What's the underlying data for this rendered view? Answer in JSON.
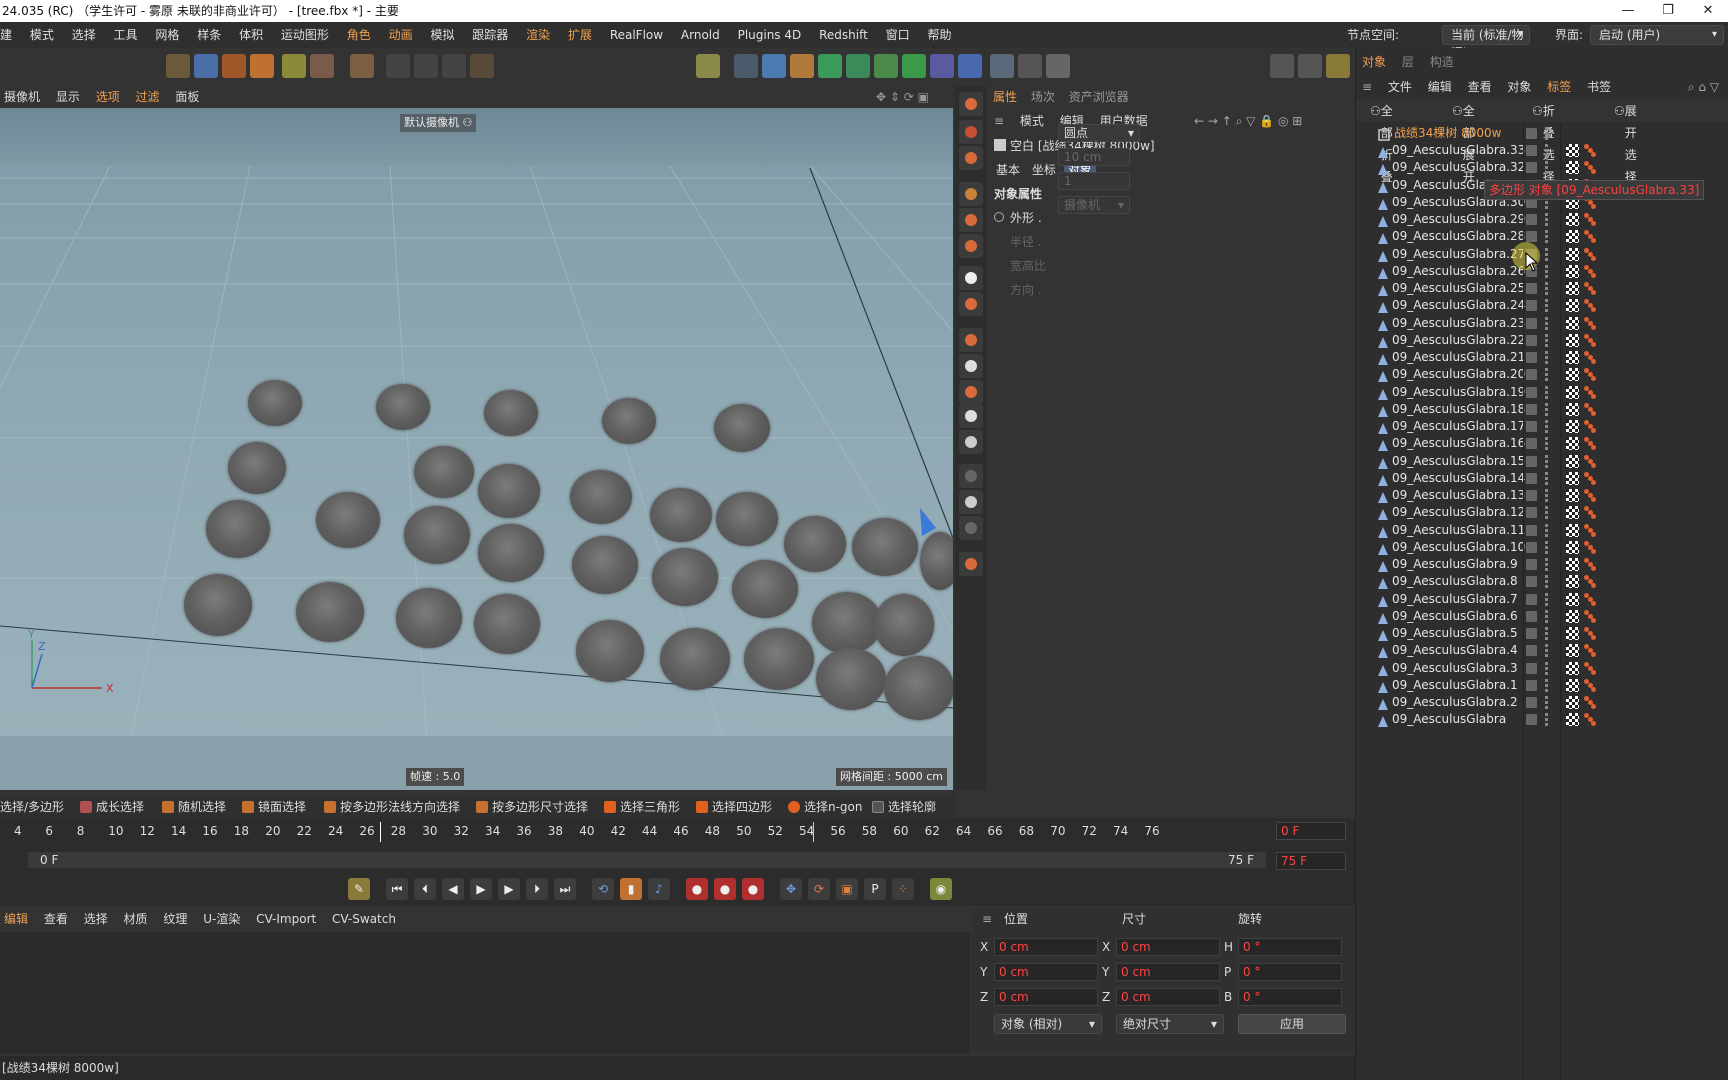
{
  "titlebar": {
    "title": "24.035 (RC)  （学生许可 - 雾原 未联的非商业许可）  - [tree.fbx *] - 主要"
  },
  "menubar": {
    "items": [
      "建",
      "模式",
      "选择",
      "工具",
      "网格",
      "样条",
      "体积",
      "运动图形",
      "角色",
      "动画",
      "模拟",
      "跟踪器",
      "渲染",
      "扩展",
      "RealFlow",
      "Arnold",
      "Plugins 4D",
      "Redshift",
      "窗口",
      "帮助"
    ],
    "node_space_label": "节点空间:",
    "node_space_value": "当前 (标准/物理)",
    "interface_label": "界面:",
    "interface_value": "启动 (用户)"
  },
  "viewport": {
    "menu": [
      "摄像机",
      "显示",
      "选项",
      "过滤",
      "面板"
    ],
    "camera_label": "默认摄像机",
    "fps": "帧速 : 5.0",
    "grid_spacing": "网格间距 : 5000 cm",
    "axis_y": "Y",
    "axis_z": "Z",
    "axis_x": "X"
  },
  "attributes": {
    "tabs": [
      "属性",
      "场次",
      "资产浏览器"
    ],
    "submenu": [
      "模式",
      "编辑",
      "用户数据"
    ],
    "object_title": "空白 [战绩34棵树 8000w]",
    "prop_tabs": [
      "基本",
      "坐标",
      "对象"
    ],
    "section": "对象属性",
    "rows": [
      {
        "label": "外形 .",
        "value": "圆点",
        "enabled": true
      },
      {
        "label": "半径 .",
        "value": "10 cm",
        "enabled": false
      },
      {
        "label": "宽高比",
        "value": "1",
        "enabled": false
      },
      {
        "label": "方向 .",
        "value": "摄像机",
        "enabled": false
      }
    ]
  },
  "objects": {
    "tabs": [
      "对象",
      "层",
      "构造"
    ],
    "menu": [
      "文件",
      "编辑",
      "查看",
      "对象",
      "标签",
      "书签"
    ],
    "buttons": [
      "全部折叠",
      "全部展开",
      "折叠选择",
      "展开选择"
    ],
    "root": "战绩34棵树 8000w",
    "items": [
      "09_AesculusGlabra.33",
      "09_AesculusGlabra.32",
      "09_AesculusGlabra.31",
      "09_AesculusGlabra.30",
      "09_AesculusGlabra.29",
      "09_AesculusGlabra.28",
      "09_AesculusGlabra.27",
      "09_AesculusGlabra.26",
      "09_AesculusGlabra.25",
      "09_AesculusGlabra.24",
      "09_AesculusGlabra.23",
      "09_AesculusGlabra.22",
      "09_AesculusGlabra.21",
      "09_AesculusGlabra.20",
      "09_AesculusGlabra.19",
      "09_AesculusGlabra.18",
      "09_AesculusGlabra.17",
      "09_AesculusGlabra.16",
      "09_AesculusGlabra.15",
      "09_AesculusGlabra.14",
      "09_AesculusGlabra.13",
      "09_AesculusGlabra.12",
      "09_AesculusGlabra.11",
      "09_AesculusGlabra.10",
      "09_AesculusGlabra.9",
      "09_AesculusGlabra.8",
      "09_AesculusGlabra.7",
      "09_AesculusGlabra.6",
      "09_AesculusGlabra.5",
      "09_AesculusGlabra.4",
      "09_AesculusGlabra.3",
      "09_AesculusGlabra.1",
      "09_AesculusGlabra.2",
      "09_AesculusGlabra"
    ],
    "tooltip": "多边形 对象 [09_AesculusGlabra.33]"
  },
  "selection_tools": [
    "选择/多边形",
    "成长选择",
    "随机选择",
    "镜面选择",
    "按多边形法线方向选择",
    "按多边形尺寸选择",
    "选择三角形",
    "选择四边形",
    "选择n-gon",
    "选择轮廓"
  ],
  "timeline": {
    "ticks": [
      "4",
      "6",
      "8",
      "10",
      "12",
      "14",
      "16",
      "18",
      "20",
      "22",
      "24",
      "26",
      "28",
      "30",
      "32",
      "34",
      "36",
      "38",
      "40",
      "42",
      "44",
      "46",
      "48",
      "50",
      "52",
      "54",
      "56",
      "58",
      "60",
      "62",
      "64",
      "66",
      "68",
      "70",
      "72",
      "74",
      "76"
    ],
    "current_frame": "0 F",
    "start_frame": "0 F",
    "end_frame": "75 F",
    "max_frame": "75 F"
  },
  "material_menu": [
    "编辑",
    "查看",
    "选择",
    "材质",
    "纹理",
    "U-渲染",
    "CV-Import",
    "CV-Swatch"
  ],
  "coords": {
    "headers": [
      "位置",
      "尺寸",
      "旋转"
    ],
    "pos": [
      {
        "axis": "X",
        "value": "0 cm"
      },
      {
        "axis": "Y",
        "value": "0 cm"
      },
      {
        "axis": "Z",
        "value": "0 cm"
      }
    ],
    "size": [
      {
        "axis": "X",
        "value": "0 cm"
      },
      {
        "axis": "Y",
        "value": "0 cm"
      },
      {
        "axis": "Z",
        "value": "0 cm"
      }
    ],
    "rot": [
      {
        "axis": "H",
        "value": "0 °"
      },
      {
        "axis": "P",
        "value": "0 °"
      },
      {
        "axis": "B",
        "value": "0 °"
      }
    ],
    "mode1": "对象 (相对)",
    "mode2": "绝对尺寸",
    "apply": "应用"
  },
  "statusbar": {
    "text": "[战绩34棵树 8000w]"
  }
}
